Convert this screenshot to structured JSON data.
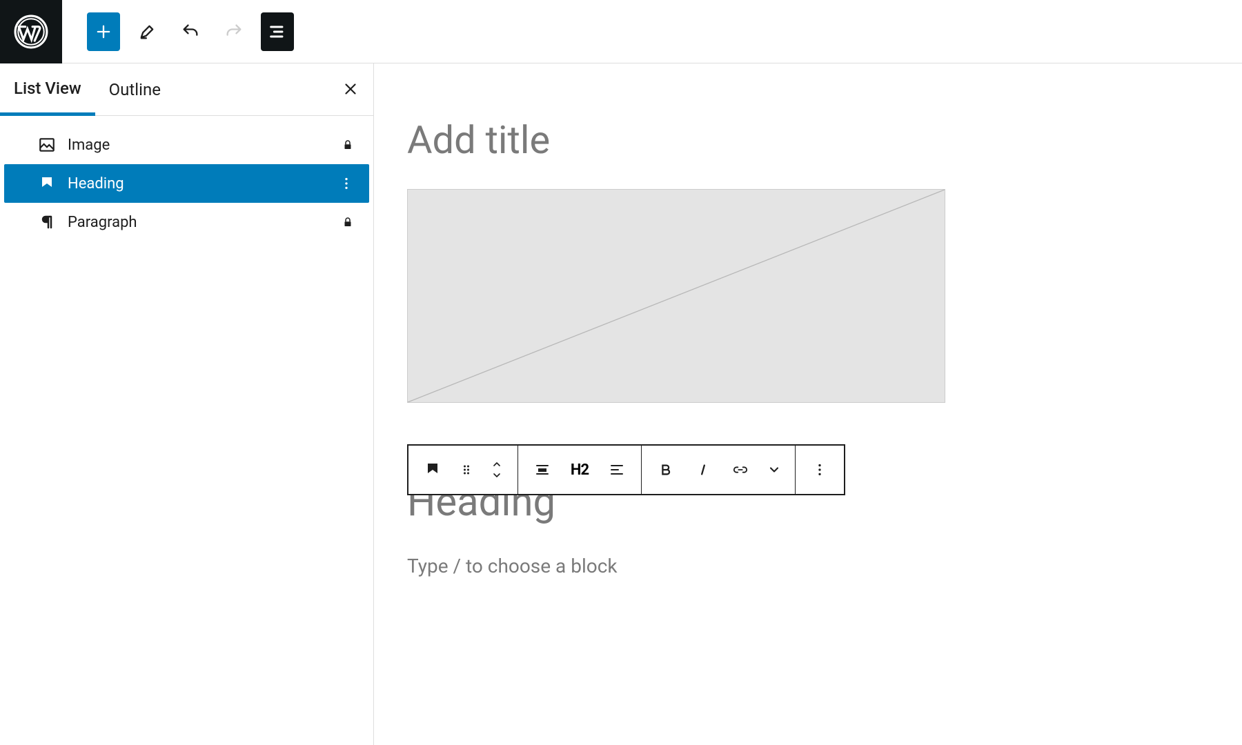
{
  "topbar": {
    "add_label": "Add block",
    "tools_label": "Tools",
    "undo_label": "Undo",
    "redo_label": "Redo",
    "listview_label": "Document Overview"
  },
  "sidebar": {
    "tabs": {
      "list_view": "List View",
      "outline": "Outline"
    },
    "close_label": "Close",
    "items": [
      {
        "label": "Image",
        "icon": "image-icon",
        "locked": true,
        "selected": false
      },
      {
        "label": "Heading",
        "icon": "heading-icon",
        "locked": false,
        "selected": true
      },
      {
        "label": "Paragraph",
        "icon": "paragraph-icon",
        "locked": true,
        "selected": false
      }
    ]
  },
  "editor": {
    "title_placeholder": "Add title",
    "heading_placeholder": "Heading",
    "paragraph_placeholder": "Type / to choose a block"
  },
  "block_toolbar": {
    "block_type": "Heading",
    "drag": "Drag",
    "move_up": "Move up",
    "move_down": "Move down",
    "align": "Align",
    "level": "H2",
    "text_align": "Align text",
    "bold": "Bold",
    "italic": "Italic",
    "link": "Link",
    "more_rich": "More",
    "options": "Options"
  }
}
